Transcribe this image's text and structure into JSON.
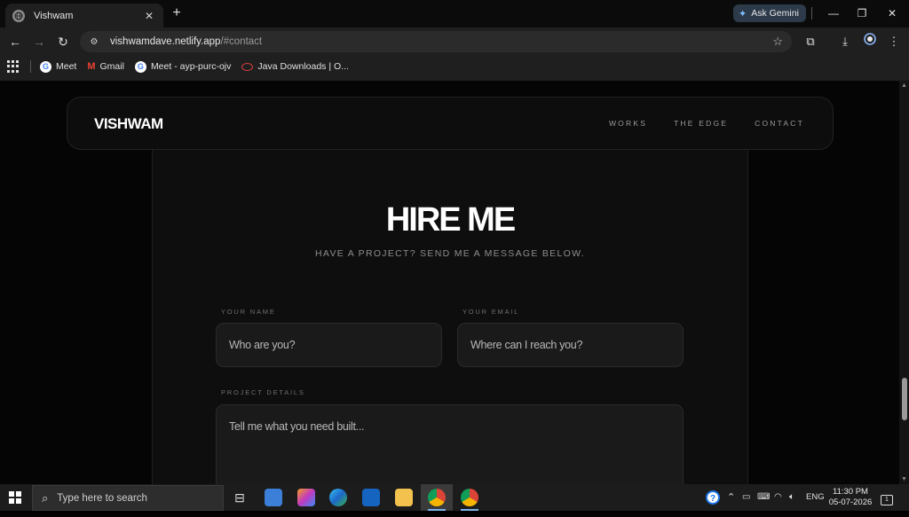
{
  "browser": {
    "tab_title": "Vishwam",
    "tab_close": "✕",
    "new_tab": "+",
    "gemini_label": "Ask Gemini",
    "url_host": "vishwamdave.netlify.app",
    "url_path": "/#contact",
    "bookmarks": [
      {
        "label": "Meet",
        "icon": "google-icon"
      },
      {
        "label": "Gmail",
        "icon": "gmail-icon"
      },
      {
        "label": "Meet - ayp-purc-ojv",
        "icon": "google-icon"
      },
      {
        "label": "Java Downloads | O...",
        "icon": "oracle-icon"
      }
    ]
  },
  "site": {
    "logo": "VISHWAM",
    "nav": [
      "WORKS",
      "THE EDGE",
      "CONTACT"
    ],
    "title": "HIRE ME",
    "subtitle": "HAVE A PROJECT? SEND ME A MESSAGE BELOW.",
    "form": {
      "name_label": "YOUR NAME",
      "name_placeholder": "Who are you?",
      "email_label": "YOUR EMAIL",
      "email_placeholder": "Where can I reach you?",
      "details_label": "PROJECT DETAILS",
      "details_placeholder": "Tell me what you need built..."
    }
  },
  "taskbar": {
    "search_placeholder": "Type here to search",
    "language": "ENG",
    "time": "11:30 PM",
    "date": "05-07-2026",
    "notification_count": "1"
  },
  "colors": {
    "page_bg": "#050505",
    "card_bg": "#0e0e0e",
    "field_bg": "#1a1a1a",
    "accent_gemini": "#2c3a4a"
  }
}
